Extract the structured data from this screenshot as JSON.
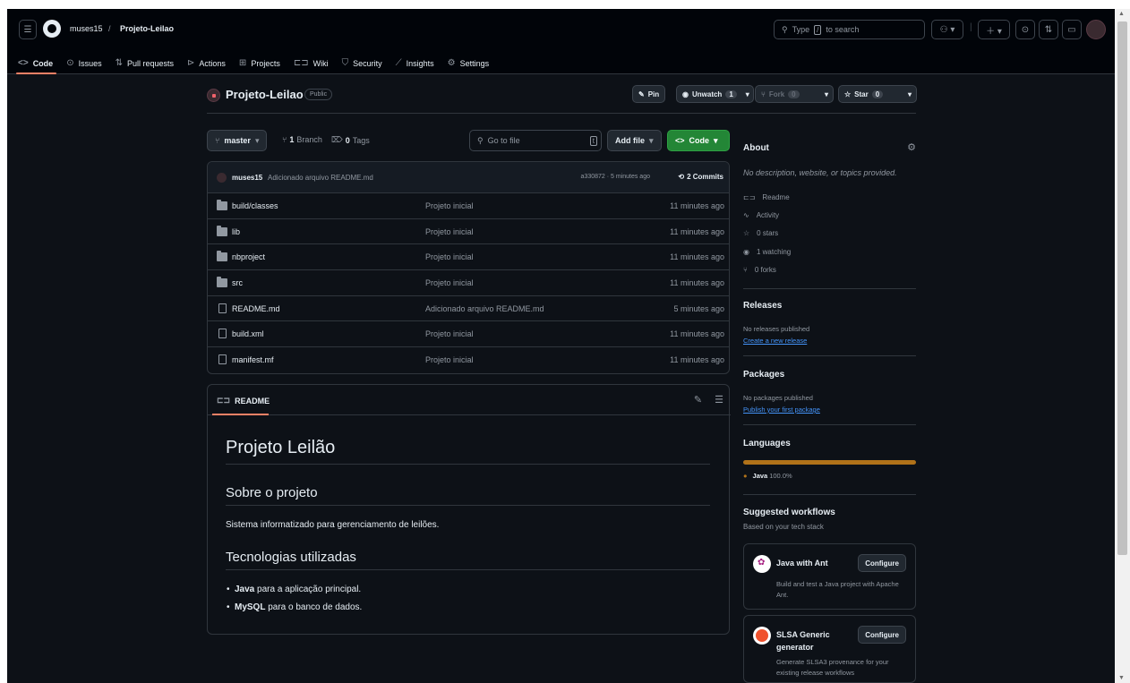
{
  "header": {
    "owner": "muses15",
    "separator": "/",
    "repo": "Projeto-Leilao",
    "search_placeholder_pre": "Type",
    "search_key": "/",
    "search_placeholder_post": "to search"
  },
  "nav": {
    "items": [
      {
        "label": "Code",
        "icon": "code-icon"
      },
      {
        "label": "Issues",
        "icon": "issue-icon"
      },
      {
        "label": "Pull requests",
        "icon": "pull-request-icon"
      },
      {
        "label": "Actions",
        "icon": "play-icon"
      },
      {
        "label": "Projects",
        "icon": "table-icon"
      },
      {
        "label": "Wiki",
        "icon": "book-icon"
      },
      {
        "label": "Security",
        "icon": "shield-icon"
      },
      {
        "label": "Insights",
        "icon": "graph-icon"
      },
      {
        "label": "Settings",
        "icon": "gear-icon"
      }
    ]
  },
  "repo": {
    "name": "Projeto-Leilao",
    "visibility": "Public",
    "pin": "Pin",
    "unwatch": "Unwatch",
    "watch_count": "1",
    "fork": "Fork",
    "fork_count": "0",
    "star": "Star",
    "star_count": "0"
  },
  "toolbar": {
    "branch": "master",
    "branch_count": "1",
    "branch_label": "Branch",
    "tag_count": "0",
    "tag_label": "Tags",
    "go_to_file": "Go to file",
    "go_key": "t",
    "add_file": "Add file",
    "code": "Code"
  },
  "commit": {
    "user": "muses15",
    "message": "Adicionado arquivo README.md",
    "meta": "a330872 · 5 minutes ago",
    "commits": "2 Commits"
  },
  "files": [
    {
      "name": "build/classes",
      "type": "folder",
      "message": "Projeto inicial",
      "age": "11 minutes ago"
    },
    {
      "name": "lib",
      "type": "folder",
      "message": "Projeto inicial",
      "age": "11 minutes ago"
    },
    {
      "name": "nbproject",
      "type": "folder",
      "message": "Projeto inicial",
      "age": "11 minutes ago"
    },
    {
      "name": "src",
      "type": "folder",
      "message": "Projeto inicial",
      "age": "11 minutes ago"
    },
    {
      "name": "README.md",
      "type": "file",
      "message": "Adicionado arquivo README.md",
      "age": "5 minutes ago"
    },
    {
      "name": "build.xml",
      "type": "file",
      "message": "Projeto inicial",
      "age": "11 minutes ago"
    },
    {
      "name": "manifest.mf",
      "type": "file",
      "message": "Projeto inicial",
      "age": "11 minutes ago"
    }
  ],
  "readme": {
    "tab": "README",
    "h1": "Projeto Leilão",
    "h2_about": "Sobre o projeto",
    "about_text": "Sistema informatizado para gerenciamento de leilões.",
    "h2_tech": "Tecnologias utilizadas",
    "tech": [
      {
        "name": "Java",
        "rest": " para a aplicação principal."
      },
      {
        "name": "MySQL",
        "rest": " para o banco de dados."
      }
    ]
  },
  "sidebar": {
    "about_title": "About",
    "about_desc": "No description, website, or topics provided.",
    "stats": [
      {
        "icon": "book-icon",
        "label": "Readme"
      },
      {
        "icon": "pulse-icon",
        "label": "Activity"
      },
      {
        "icon": "star-icon",
        "label": "0 stars"
      },
      {
        "icon": "eye-icon",
        "label": "1 watching"
      },
      {
        "icon": "fork-icon",
        "label": "0 forks"
      }
    ],
    "releases_title": "Releases",
    "releases_none": "No releases published",
    "releases_link": "Create a new release",
    "packages_title": "Packages",
    "packages_none": "No packages published",
    "packages_link": "Publish your first package",
    "languages_title": "Languages",
    "language_name": "Java",
    "language_pct": "100.0%",
    "language_color": "#b07219",
    "workflows_title": "Suggested workflows",
    "workflows_sub": "Based on your tech stack",
    "workflows": [
      {
        "name": "Java with Ant",
        "desc": "Build and test a Java project with Apache Ant.",
        "button": "Configure"
      },
      {
        "name": "SLSA Generic generator",
        "desc": "Generate SLSA3 provenance for your existing release workflows",
        "button": "Configure"
      }
    ]
  },
  "colors": {
    "background": "#0d1117",
    "header": "#010409",
    "accent_underline": "#f78166",
    "green_button": "#238636",
    "link": "#4493f8"
  }
}
